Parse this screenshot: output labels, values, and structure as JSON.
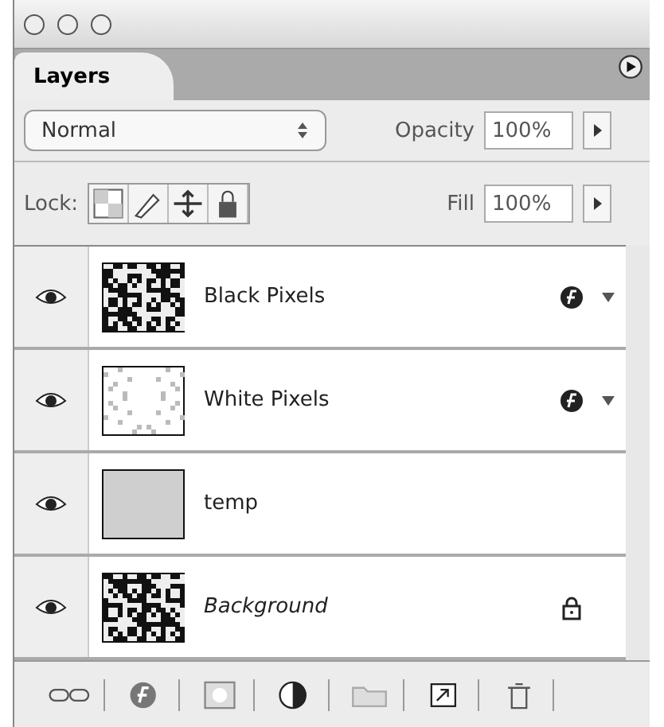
{
  "tabs": [
    {
      "label": "Layers",
      "selected": true
    }
  ],
  "blend_mode": {
    "value": "Normal"
  },
  "opacity": {
    "label": "Opacity",
    "value": "100%"
  },
  "lock": {
    "label": "Lock:"
  },
  "fill": {
    "label": "Fill",
    "value": "100%"
  },
  "layers": [
    {
      "name": "Black Pixels",
      "visible": true,
      "kind": "dark",
      "effects": true,
      "locked": false,
      "italic": false
    },
    {
      "name": "White Pixels",
      "visible": true,
      "kind": "light",
      "effects": true,
      "locked": false,
      "italic": false
    },
    {
      "name": "temp",
      "visible": true,
      "kind": "flat",
      "effects": false,
      "locked": false,
      "italic": false
    },
    {
      "name": "Background",
      "visible": true,
      "kind": "dark",
      "effects": false,
      "locked": true,
      "italic": true
    }
  ]
}
